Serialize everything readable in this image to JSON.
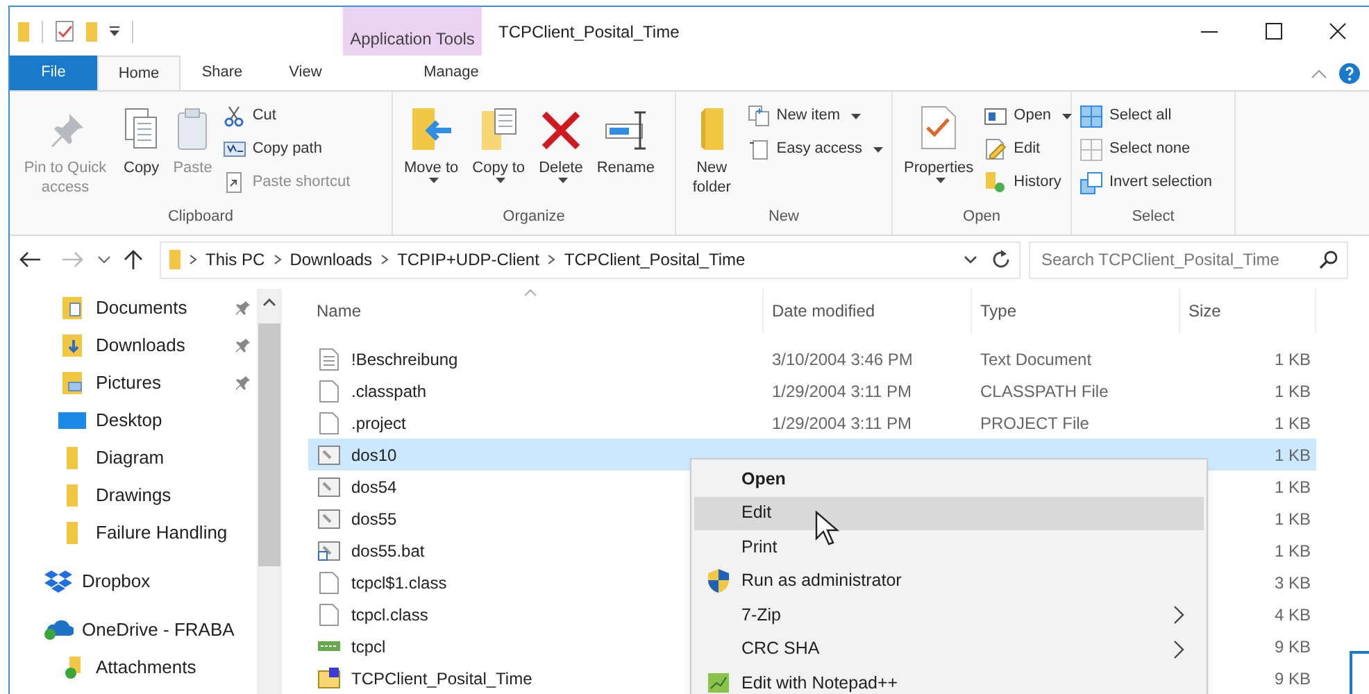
{
  "window": {
    "title": "TCPClient_Posital_Time",
    "contextual_tab_group": "Application Tools"
  },
  "ribbon_tabs": [
    {
      "label": "File",
      "kind": "file",
      "selected": false
    },
    {
      "label": "Home",
      "kind": "tab",
      "selected": true
    },
    {
      "label": "Share",
      "kind": "tab",
      "selected": false
    },
    {
      "label": "View",
      "kind": "tab",
      "selected": false
    },
    {
      "label": "Manage",
      "kind": "contextual",
      "selected": false
    }
  ],
  "ribbon_groups": [
    {
      "label": "Clipboard",
      "items": [
        {
          "kind": "large",
          "label": "Pin to Quick access",
          "disabled": true,
          "dropdown": false
        },
        {
          "kind": "large",
          "label": "Copy",
          "disabled": false,
          "dropdown": false
        },
        {
          "kind": "large",
          "label": "Paste",
          "disabled": true,
          "dropdown": false
        },
        {
          "kind": "stack",
          "items": [
            {
              "label": "Cut",
              "disabled": false,
              "dropdown": false
            },
            {
              "label": "Copy path",
              "disabled": false,
              "dropdown": false
            },
            {
              "label": "Paste shortcut",
              "disabled": true,
              "dropdown": false
            }
          ]
        }
      ]
    },
    {
      "label": "Organize",
      "items": [
        {
          "kind": "large",
          "label": "Move to",
          "disabled": false,
          "dropdown": true
        },
        {
          "kind": "large",
          "label": "Copy to",
          "disabled": false,
          "dropdown": true
        },
        {
          "kind": "large",
          "label": "Delete",
          "disabled": false,
          "dropdown": true
        },
        {
          "kind": "large",
          "label": "Rename",
          "disabled": false,
          "dropdown": false
        }
      ]
    },
    {
      "label": "New",
      "items": [
        {
          "kind": "large",
          "label": "New folder",
          "disabled": false,
          "dropdown": false
        },
        {
          "kind": "stack",
          "items": [
            {
              "label": "New item",
              "disabled": false,
              "dropdown": true
            },
            {
              "label": "Easy access",
              "disabled": false,
              "dropdown": true
            }
          ]
        }
      ]
    },
    {
      "label": "Open",
      "items": [
        {
          "kind": "large",
          "label": "Properties",
          "disabled": false,
          "dropdown": true
        },
        {
          "kind": "stack",
          "items": [
            {
              "label": "Open",
              "disabled": false,
              "dropdown": true
            },
            {
              "label": "Edit",
              "disabled": false,
              "dropdown": false
            },
            {
              "label": "History",
              "disabled": false,
              "dropdown": false
            }
          ]
        }
      ]
    },
    {
      "label": "Select",
      "items": [
        {
          "kind": "stack",
          "items": [
            {
              "label": "Select all",
              "disabled": false,
              "dropdown": false
            },
            {
              "label": "Select none",
              "disabled": false,
              "dropdown": false
            },
            {
              "label": "Invert selection",
              "disabled": false,
              "dropdown": false
            }
          ]
        }
      ]
    }
  ],
  "address_bar": {
    "path": [
      "This PC",
      "Downloads",
      "TCPIP+UDP-Client",
      "TCPClient_Posital_Time"
    ],
    "search_placeholder": "Search TCPClient_Posital_Time"
  },
  "nav_pane": {
    "quick_access_items": [
      {
        "label": "Documents",
        "kind": "documents",
        "pinned": true
      },
      {
        "label": "Downloads",
        "kind": "downloads",
        "pinned": true
      },
      {
        "label": "Pictures",
        "kind": "pictures",
        "pinned": true
      },
      {
        "label": "Desktop",
        "kind": "desktop",
        "pinned": false
      },
      {
        "label": "Diagram",
        "kind": "folder",
        "pinned": false
      },
      {
        "label": "Drawings",
        "kind": "folder",
        "pinned": false
      },
      {
        "label": "Failure Handling",
        "kind": "folder",
        "pinned": false
      }
    ],
    "items": [
      {
        "label": "Dropbox",
        "kind": "dropbox"
      },
      {
        "label": "OneDrive - FRABA",
        "kind": "onedrive",
        "children": [
          {
            "label": "Attachments",
            "kind": "synced"
          }
        ]
      }
    ]
  },
  "file_list": {
    "columns": [
      "Name",
      "Date modified",
      "Type",
      "Size"
    ],
    "rows": [
      {
        "name": "!Beschreibung",
        "kind": "text",
        "date": "3/10/2004 3:46 PM",
        "type": "Text Document",
        "size": "1 KB",
        "selected": false
      },
      {
        "name": ".classpath",
        "kind": "blank",
        "date": "1/29/2004 3:11 PM",
        "type": "CLASSPATH File",
        "size": "1 KB",
        "selected": false
      },
      {
        "name": ".project",
        "kind": "blank",
        "date": "1/29/2004 3:11 PM",
        "type": "PROJECT File",
        "size": "1 KB",
        "selected": false
      },
      {
        "name": "dos10",
        "kind": "batch",
        "size": "1 KB",
        "selected": true
      },
      {
        "name": "dos54",
        "kind": "batch",
        "size": "1 KB",
        "selected": false
      },
      {
        "name": "dos55",
        "kind": "batch",
        "size": "1 KB",
        "selected": false
      },
      {
        "name": "dos55.bat",
        "kind": "shortcut",
        "size": "1 KB",
        "selected": false
      },
      {
        "name": "tcpcl$1.class",
        "kind": "blank",
        "size": "3 KB",
        "selected": false
      },
      {
        "name": "tcpcl.class",
        "kind": "blank",
        "size": "4 KB",
        "selected": false
      },
      {
        "name": "tcpcl",
        "kind": "exe",
        "size": "9 KB",
        "selected": false
      },
      {
        "name": "TCPClient_Posital_Time",
        "kind": "project",
        "size": "9 KB",
        "selected": false
      }
    ]
  },
  "context_menu": [
    {
      "label": "Open",
      "kind": "plain",
      "default": true,
      "submenu": false,
      "selected": false
    },
    {
      "label": "Edit",
      "kind": "plain",
      "default": false,
      "submenu": false,
      "selected": true
    },
    {
      "label": "Print",
      "kind": "plain",
      "default": false,
      "submenu": false,
      "selected": false
    },
    {
      "label": "Run as administrator",
      "kind": "shield",
      "default": false,
      "submenu": false,
      "selected": false
    },
    {
      "label": "7-Zip",
      "kind": "plain",
      "default": false,
      "submenu": true,
      "selected": false
    },
    {
      "label": "CRC SHA",
      "kind": "plain",
      "default": false,
      "submenu": true,
      "selected": false
    },
    {
      "label": "Edit with Notepad++",
      "kind": "notepad",
      "default": false,
      "submenu": false,
      "selected": false
    }
  ]
}
